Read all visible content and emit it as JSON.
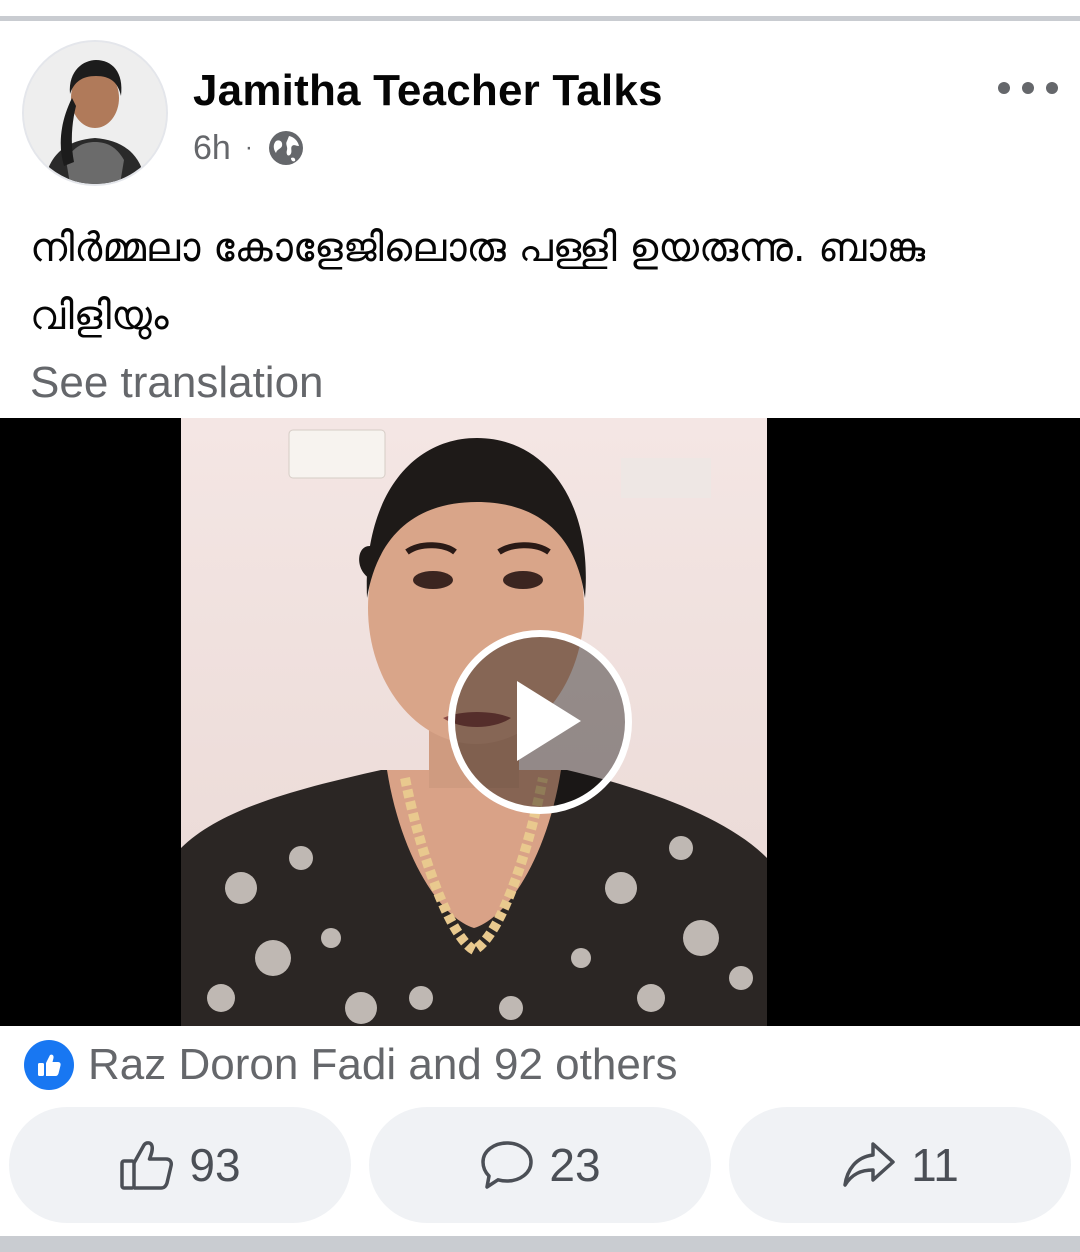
{
  "post": {
    "author": "Jamitha Teacher Talks",
    "time": "6h",
    "separator": "·",
    "privacy_icon": "globe-icon",
    "text": "നിർമ്മലാ കോളേജിലൊരു പള്ളി ഉയരുന്നു. ബാങ്കു വിളിയും",
    "see_translation": "See translation"
  },
  "video": {
    "play_icon": "play-icon"
  },
  "reactions": {
    "summary": "Raz Doron Fadi and 92 others",
    "icon": "like-badge-icon"
  },
  "actions": {
    "like_count": "93",
    "comment_count": "23",
    "share_count": "11"
  },
  "colors": {
    "accent": "#1877f2",
    "secondary_text": "#65676b",
    "button_bg": "#f0f2f5",
    "divider": "#c9ccd1"
  }
}
